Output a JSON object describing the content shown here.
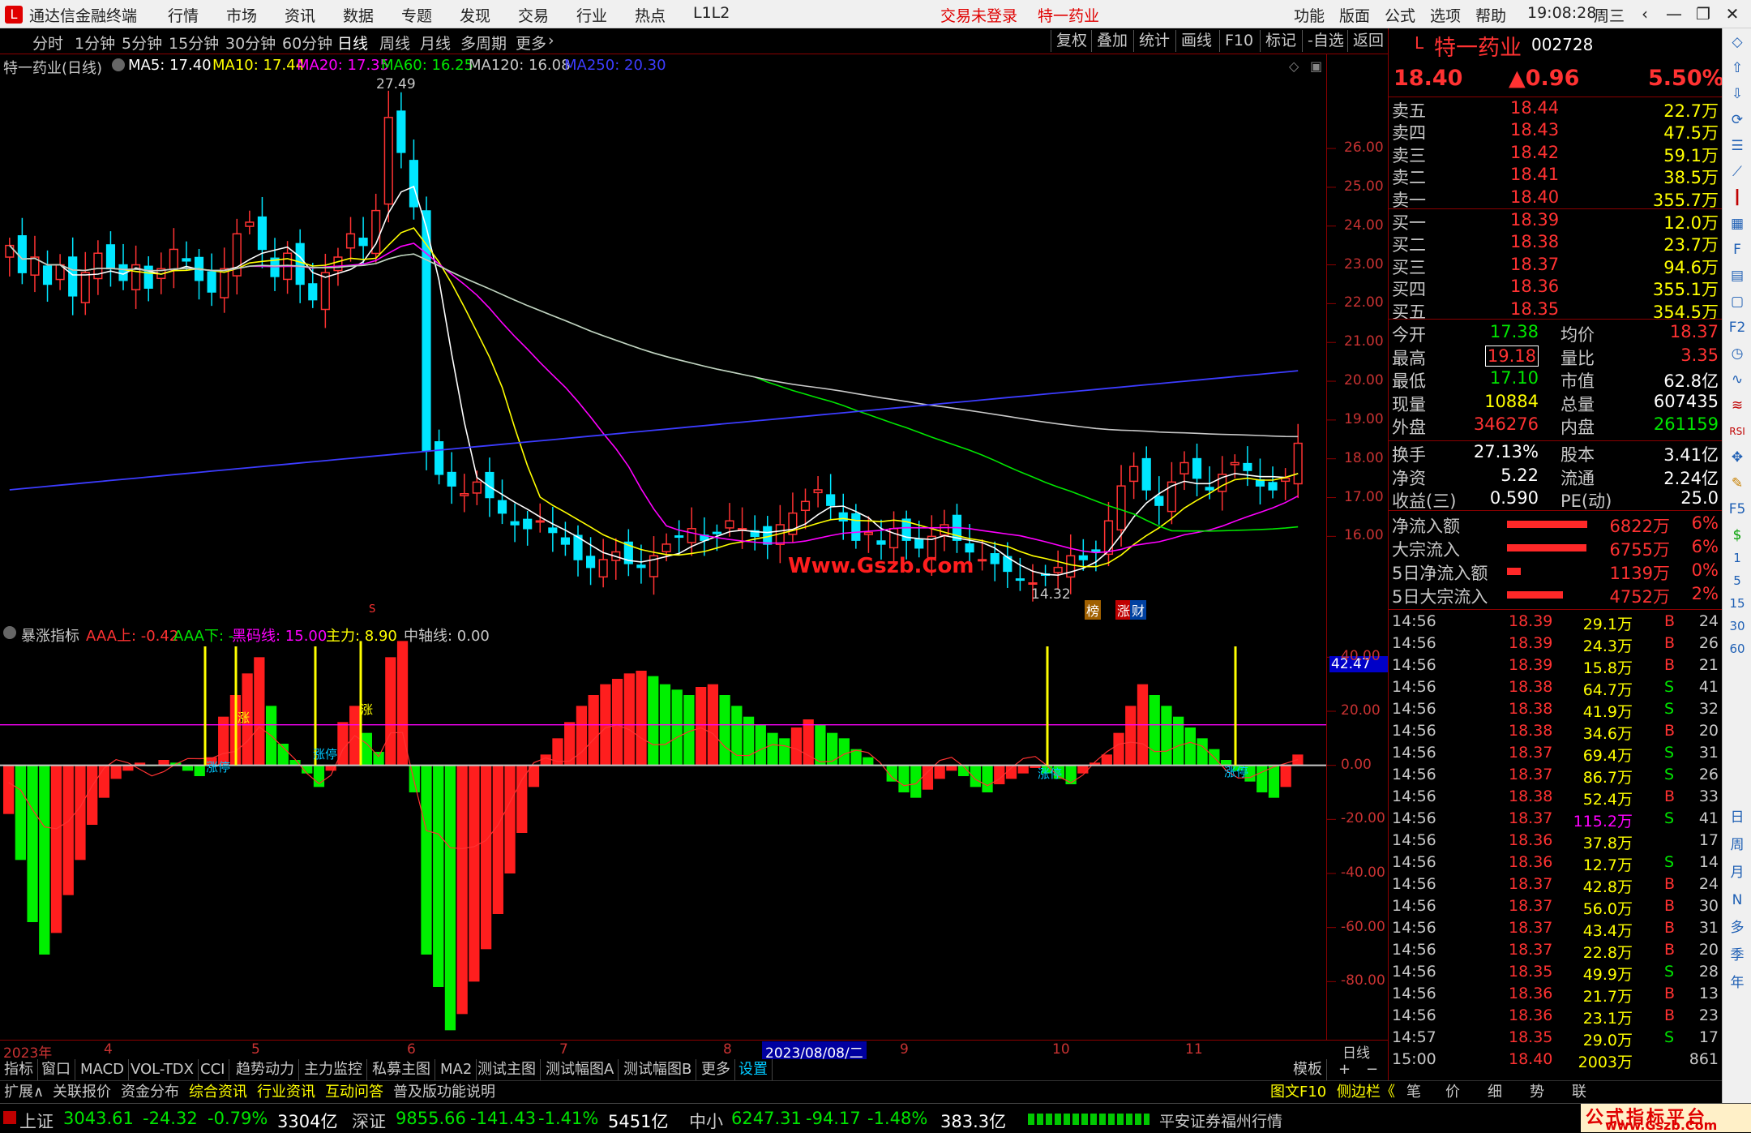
{
  "titlebar": {
    "app_name": "通达信金融终端",
    "menu": [
      "行情",
      "市场",
      "资讯",
      "数据",
      "专题",
      "发现",
      "交易",
      "行业",
      "热点",
      "L1L2"
    ],
    "login_status": "交易未登录",
    "stock_name": "特一药业",
    "right_menu": [
      "功能",
      "版面",
      "公式",
      "选项",
      "帮助"
    ],
    "time": "19:08:28",
    "weekday": "周三"
  },
  "periodbar": {
    "periods": [
      "分时",
      "1分钟",
      "5分钟",
      "15分钟",
      "30分钟",
      "60分钟",
      "日线",
      "周线",
      "月线",
      "多周期",
      "更多"
    ],
    "selected": "日线",
    "buttons": [
      "复权",
      "叠加",
      "统计",
      "画线",
      "F10",
      "标记",
      "-自选",
      "返回"
    ]
  },
  "main_legend": {
    "title": "特一药业(日线)",
    "ma": [
      {
        "label": "MA5: 17.40",
        "color": "#ffffff"
      },
      {
        "label": "MA10: 17.44",
        "color": "#ffff00"
      },
      {
        "label": "MA20: 17.35",
        "color": "#ff00ff"
      },
      {
        "label": "MA60: 16.25",
        "color": "#00e600"
      },
      {
        "label": "MA120: 16.08",
        "color": "#c8c8c8"
      },
      {
        "label": "MA250: 20.30",
        "color": "#3c3cff"
      }
    ],
    "high_label": "27.49",
    "low_label": "14.32",
    "watermark": "Www.Gszb.Com",
    "badges": [
      "榜",
      "涨",
      "财"
    ],
    "s_marker": "S"
  },
  "main_yticks": [
    "26.00",
    "25.00",
    "24.00",
    "23.00",
    "22.00",
    "21.00",
    "20.00",
    "19.00",
    "18.00",
    "17.00",
    "16.00"
  ],
  "sub_legend": {
    "title": "暴涨指标",
    "items": [
      {
        "label": "AAA上: -0.42",
        "color": "#ff3232"
      },
      {
        "label": "AAA下: -",
        "color": "#00e600"
      },
      {
        "label": "黑码线: 15.00",
        "color": "#ff00ff"
      },
      {
        "label": "主力: 8.90",
        "color": "#ffff00"
      },
      {
        "label": "中轴线: 0.00",
        "color": "#c8c8c8"
      }
    ],
    "signals": [
      "涨停",
      "涨",
      "涨停",
      "涨",
      "涨停",
      "涨停"
    ]
  },
  "sub_yticks": [
    "40.00",
    "20.00",
    "0.00",
    "-20.00",
    "-40.00",
    "-60.00",
    "-80.00"
  ],
  "sub_highlight": "42.47",
  "xaxis": {
    "labels": [
      "2023年",
      "4",
      "5",
      "6",
      "7",
      "8",
      "9",
      "10",
      "11"
    ],
    "cursor_date": "2023/08/08/二",
    "period": "日线"
  },
  "bottom_tabs": [
    "指标",
    "窗口",
    "MACD",
    "VOL-TDX",
    "CCI",
    "趋势动力",
    "主力监控",
    "私募主图",
    "MA2",
    "测试主图",
    "测试幅图A",
    "测试幅图B",
    "更多",
    "设置"
  ],
  "bottom_right": {
    "template": "模板",
    "plus": "+",
    "minus": "−"
  },
  "bottom_tabs2": [
    "扩展∧",
    "关联报价",
    "资金分布",
    "综合资讯",
    "行业资讯",
    "互动问答",
    "普及版功能说明"
  ],
  "bottom_right2": [
    "图文F10",
    "侧边栏《",
    "笔",
    "价",
    "细",
    "势",
    "联"
  ],
  "statusbar": {
    "sh": {
      "name": "上证",
      "price": "3043.61",
      "chg": "-24.32",
      "pct": "-0.79%",
      "amt": "3304亿"
    },
    "sz": {
      "name": "深证",
      "price": "9855.66",
      "chg": "-141.43",
      "pct": "-1.41%",
      "amt": "5451亿"
    },
    "zx": {
      "name": "中小",
      "price": "6247.31",
      "chg": "-94.17",
      "pct": "-1.48%",
      "amt": "383.3亿"
    },
    "broker": "平安证券福州行情",
    "logo_text": "公式指标平台",
    "logo_url": "www.Gszb.Com"
  },
  "quote": {
    "prefix": "L",
    "name": "特一药业",
    "code": "002728",
    "price": "18.40",
    "change": "▲0.96",
    "pct": "5.50%",
    "asks": [
      {
        "label": "卖五",
        "price": "18.44",
        "vol": "22.7万"
      },
      {
        "label": "卖四",
        "price": "18.43",
        "vol": "47.5万"
      },
      {
        "label": "卖三",
        "price": "18.42",
        "vol": "59.1万"
      },
      {
        "label": "卖二",
        "price": "18.41",
        "vol": "38.5万"
      },
      {
        "label": "卖一",
        "price": "18.40",
        "vol": "355.7万"
      }
    ],
    "bids": [
      {
        "label": "买一",
        "price": "18.39",
        "vol": "12.0万"
      },
      {
        "label": "买二",
        "price": "18.38",
        "vol": "23.7万"
      },
      {
        "label": "买三",
        "price": "18.37",
        "vol": "94.6万"
      },
      {
        "label": "买四",
        "price": "18.36",
        "vol": "355.1万"
      },
      {
        "label": "买五",
        "price": "18.35",
        "vol": "354.5万"
      }
    ],
    "stats": [
      {
        "l1": "今开",
        "v1": "17.38",
        "c1": "#00e600",
        "l2": "均价",
        "v2": "18.37",
        "c2": "#ff3232"
      },
      {
        "l1": "最高",
        "v1": "19.18",
        "c1": "#ff3232",
        "l2": "量比",
        "v2": "3.35",
        "c2": "#ff3232"
      },
      {
        "l1": "最低",
        "v1": "17.10",
        "c1": "#00e600",
        "l2": "市值",
        "v2": "62.8亿",
        "c2": "#ffffff"
      },
      {
        "l1": "现量",
        "v1": "10884",
        "c1": "#ffff00",
        "l2": "总量",
        "v2": "607435",
        "c2": "#ffffff"
      },
      {
        "l1": "外盘",
        "v1": "346276",
        "c1": "#ff3232",
        "l2": "内盘",
        "v2": "261159",
        "c2": "#00e600"
      }
    ],
    "stats2": [
      {
        "l1": "换手",
        "v1": "27.13%",
        "l2": "股本",
        "v2": "3.41亿"
      },
      {
        "l1": "净资",
        "v1": "5.22",
        "l2": "流通",
        "v2": "2.24亿"
      },
      {
        "l1": "收益(三)",
        "v1": "0.590",
        "l2": "PE(动)",
        "v2": "25.0"
      }
    ],
    "flows": [
      {
        "label": "净流入额",
        "amt": "6822万",
        "pct": "6%",
        "bar": 0.95
      },
      {
        "label": "大宗流入",
        "amt": "6755万",
        "pct": "6%",
        "bar": 0.94
      },
      {
        "label": "5日净流入额",
        "amt": "1139万",
        "pct": "0%",
        "bar": 0.16
      },
      {
        "label": "5日大宗流入",
        "amt": "4752万",
        "pct": "2%",
        "bar": 0.66
      }
    ],
    "ticks": [
      {
        "t": "14:56",
        "p": "18.39",
        "v": "29.1万",
        "bs": "B",
        "n": "24"
      },
      {
        "t": "14:56",
        "p": "18.39",
        "v": "24.3万",
        "bs": "B",
        "n": "26"
      },
      {
        "t": "14:56",
        "p": "18.39",
        "v": "15.8万",
        "bs": "B",
        "n": "21"
      },
      {
        "t": "14:56",
        "p": "18.38",
        "v": "64.7万",
        "bs": "S",
        "n": "41"
      },
      {
        "t": "14:56",
        "p": "18.38",
        "v": "41.9万",
        "bs": "S",
        "n": "32"
      },
      {
        "t": "14:56",
        "p": "18.38",
        "v": "34.6万",
        "bs": "B",
        "n": "20"
      },
      {
        "t": "14:56",
        "p": "18.37",
        "v": "69.4万",
        "bs": "S",
        "n": "31"
      },
      {
        "t": "14:56",
        "p": "18.37",
        "v": "86.7万",
        "bs": "S",
        "n": "26"
      },
      {
        "t": "14:56",
        "p": "18.38",
        "v": "52.4万",
        "bs": "B",
        "n": "33"
      },
      {
        "t": "14:56",
        "p": "18.37",
        "v": "115.2万",
        "bs": "S",
        "n": "41"
      },
      {
        "t": "14:56",
        "p": "18.36",
        "v": "37.8万",
        "bs": "",
        "n": "17"
      },
      {
        "t": "14:56",
        "p": "18.36",
        "v": "12.7万",
        "bs": "S",
        "n": "14"
      },
      {
        "t": "14:56",
        "p": "18.37",
        "v": "42.8万",
        "bs": "B",
        "n": "24"
      },
      {
        "t": "14:56",
        "p": "18.37",
        "v": "56.0万",
        "bs": "B",
        "n": "30"
      },
      {
        "t": "14:56",
        "p": "18.37",
        "v": "43.4万",
        "bs": "B",
        "n": "31"
      },
      {
        "t": "14:56",
        "p": "18.37",
        "v": "22.8万",
        "bs": "B",
        "n": "20"
      },
      {
        "t": "14:56",
        "p": "18.35",
        "v": "49.9万",
        "bs": "S",
        "n": "28"
      },
      {
        "t": "14:56",
        "p": "18.36",
        "v": "21.7万",
        "bs": "B",
        "n": "13"
      },
      {
        "t": "14:56",
        "p": "18.36",
        "v": "23.1万",
        "bs": "B",
        "n": "23"
      },
      {
        "t": "14:57",
        "p": "18.35",
        "v": "29.0万",
        "bs": "S",
        "n": "17"
      },
      {
        "t": "15:00",
        "p": "18.40",
        "v": "2003万",
        "bs": "",
        "n": "861"
      }
    ]
  },
  "toolstrip": [
    "日",
    "周",
    "月",
    "N",
    "多",
    "季",
    "年"
  ],
  "toolstrip_nums": [
    "1",
    "5",
    "15",
    "30",
    "60"
  ],
  "chart_data": [
    {
      "type": "candlestick",
      "title": "特一药业(日线)",
      "y_range": [
        14.0,
        27.8
      ],
      "high": 27.49,
      "low": 14.32,
      "ma_last": {
        "MA5": 17.4,
        "MA10": 17.44,
        "MA20": 17.35,
        "MA60": 16.25,
        "MA120": 16.08,
        "MA250": 20.3
      },
      "close_series_approx": [
        23.5,
        22.8,
        23.2,
        22.5,
        23.0,
        22.2,
        22.8,
        23.3,
        22.9,
        22.6,
        23.0,
        22.4,
        22.9,
        23.4,
        23.1,
        22.6,
        22.3,
        22.9,
        23.8,
        24.1,
        23.4,
        22.7,
        23.3,
        22.5,
        22.1,
        22.8,
        23.2,
        23.8,
        23.5,
        24.4,
        26.8,
        25.9,
        24.5,
        18.2,
        17.6,
        17.3,
        17.1,
        17.4,
        17.0,
        16.6,
        16.3,
        16.2,
        16.4,
        16.1,
        15.8,
        15.4,
        15.2,
        15.4,
        15.6,
        15.3,
        15.2,
        15.5,
        15.8,
        16.0,
        16.2,
        15.9,
        16.1,
        16.4,
        16.2,
        16.0,
        15.8,
        16.3,
        16.6,
        16.9,
        17.2,
        16.8,
        16.4,
        15.9,
        16.1,
        15.8,
        16.2,
        15.9,
        15.7,
        16.0,
        16.3,
        15.9,
        15.6,
        15.4,
        15.3,
        15.1,
        14.9,
        14.8,
        15.0,
        15.2,
        15.5,
        15.4,
        15.6,
        16.4,
        17.3,
        17.8,
        17.2,
        16.8,
        17.4,
        17.9,
        17.5,
        17.2,
        17.6,
        17.9,
        17.7,
        17.3,
        17.2,
        17.5,
        18.4
      ]
    },
    {
      "type": "bar",
      "title": "暴涨指标",
      "y_range": [
        -100,
        50
      ],
      "series": [
        {
          "name": "AAA上",
          "last": -0.42
        },
        {
          "name": "黑码线",
          "value": 15.0
        },
        {
          "name": "主力",
          "last": 8.9
        },
        {
          "name": "中轴线",
          "value": 0.0
        }
      ],
      "values_approx": [
        -18,
        -35,
        -58,
        -70,
        -62,
        -48,
        -35,
        -22,
        -12,
        -5,
        -2,
        1,
        0,
        2,
        1,
        -2,
        -4,
        3,
        18,
        26,
        34,
        40,
        22,
        8,
        2,
        -3,
        -8,
        -2,
        16,
        22,
        12,
        5,
        40,
        46,
        -10,
        -70,
        -82,
        -98,
        -92,
        -80,
        -68,
        -55,
        -40,
        -25,
        -8,
        4,
        10,
        16,
        22,
        26,
        30,
        32,
        34,
        35,
        33,
        30,
        28,
        26,
        29,
        30,
        26,
        22,
        18,
        15,
        12,
        10,
        14,
        17,
        15,
        12,
        10,
        6,
        3,
        0,
        -6,
        -10,
        -12,
        -9,
        -5,
        -2,
        -4,
        -8,
        -10,
        -7,
        -5,
        -3,
        -1,
        -3,
        -5,
        -7,
        -3,
        1,
        4,
        12,
        22,
        30,
        26,
        22,
        18,
        14,
        10,
        6,
        2,
        -2,
        -6,
        -10,
        -12,
        -8,
        4
      ]
    }
  ]
}
